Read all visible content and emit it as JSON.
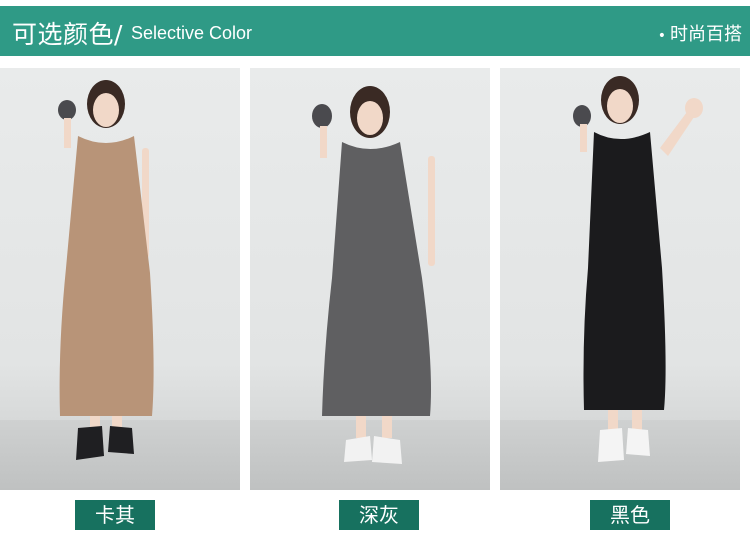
{
  "header": {
    "title_cn": "可选颜色/",
    "title_en": "Selective Color",
    "tag": "时尚百搭",
    "tag_bullet": "•"
  },
  "colors": {
    "header_bg": "#2f9a86",
    "label_bg": "#17715f",
    "khaki": "#b89478",
    "dark_gray": "#5f5f61",
    "black": "#1b1b1d"
  },
  "swatches": [
    {
      "label": "卡其",
      "dress_color": "#b89478"
    },
    {
      "label": "深灰",
      "dress_color": "#5f5f61"
    },
    {
      "label": "黑色",
      "dress_color": "#1b1b1d"
    }
  ]
}
